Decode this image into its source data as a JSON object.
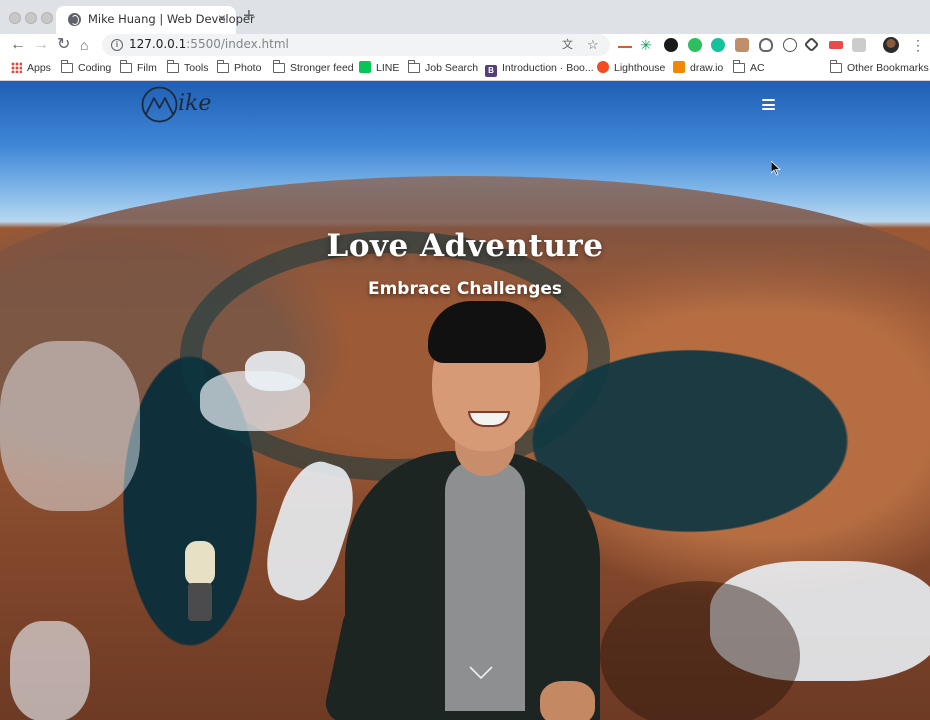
{
  "browser": {
    "tab_title": "Mike Huang | Web Developer",
    "tab_close": "×",
    "new_tab": "+",
    "url_host": "127.0.0.1",
    "url_rest": ":5500/index.html",
    "bookmarks": [
      {
        "label": "Apps",
        "icon": "apps-grid-icon"
      },
      {
        "label": "Coding",
        "icon": "folder-icon"
      },
      {
        "label": "Film",
        "icon": "folder-icon"
      },
      {
        "label": "Tools",
        "icon": "folder-icon"
      },
      {
        "label": "Photo",
        "icon": "folder-icon"
      },
      {
        "label": "Stronger feed",
        "icon": "folder-icon"
      },
      {
        "label": "LINE",
        "icon": "line-icon"
      },
      {
        "label": "Job Search",
        "icon": "folder-icon"
      },
      {
        "label": "Introduction · Boo...",
        "icon": "bootstrap-icon"
      },
      {
        "label": "Lighthouse",
        "icon": "lighthouse-icon"
      },
      {
        "label": "draw.io",
        "icon": "drawio-icon"
      },
      {
        "label": "AC",
        "icon": "folder-icon"
      },
      {
        "label": "Other Bookmarks",
        "icon": "folder-icon"
      }
    ]
  },
  "site": {
    "logo_text": "ike",
    "hero_title": "Love Adventure",
    "hero_subtitle": "Embrace Challenges"
  }
}
